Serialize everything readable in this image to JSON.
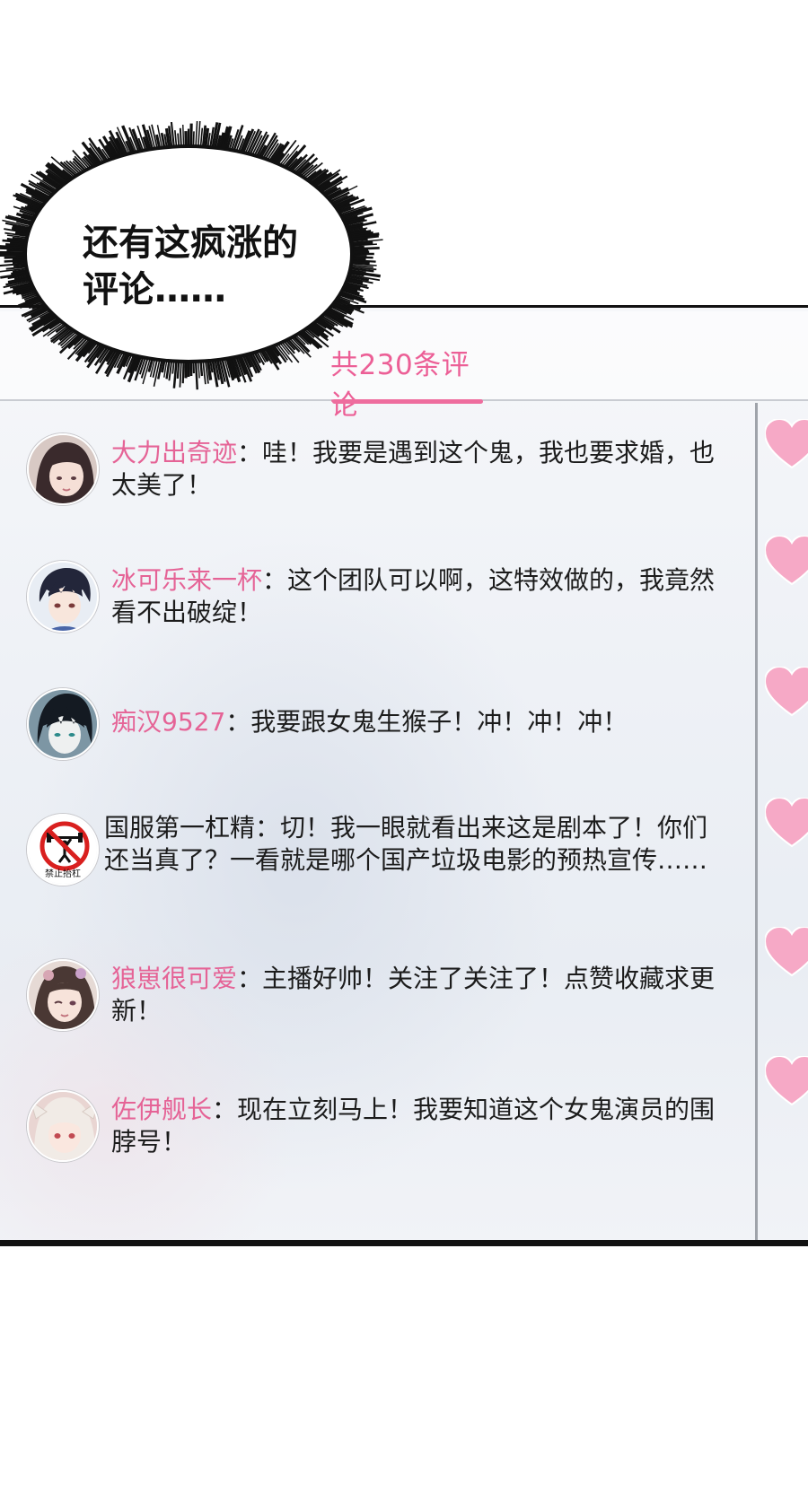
{
  "narration": {
    "bubble_text": "还有这疯涨的评论……"
  },
  "comments_panel": {
    "tab_title": "共230条评论",
    "accent_color": "#ec5f96",
    "heart_color": "#f6a9c6",
    "comments": [
      {
        "user": "大力出奇迹",
        "separator": "：",
        "text": "哇！我要是遇到这个鬼，我也要求婚，也太美了！",
        "avatar_icon": "anime-girl-avatar"
      },
      {
        "user": "冰可乐来一杯",
        "separator": "：",
        "text": "这个团队可以啊，这特效做的，我竟然看不出破绽！",
        "avatar_icon": "anime-boy-avatar"
      },
      {
        "user": "痴汉9527",
        "separator": "：",
        "text": "我要跟女鬼生猴子！冲！冲！冲！",
        "avatar_icon": "dark-hair-boy-avatar"
      },
      {
        "user": "国服第一杠精",
        "separator": "：",
        "text": "切！我一眼就看出来这是剧本了！你们还当真了？一看就是哪个国产垃圾电影的预热宣传……",
        "avatar_icon": "no-barbell-sign-avatar",
        "avatar_caption": "禁止抬杠"
      },
      {
        "user": "狼崽很可爱",
        "separator": "：",
        "text": "主播好帅！关注了关注了！点赞收藏求更新！",
        "avatar_icon": "winking-girl-avatar"
      },
      {
        "user": "佐伊舰长",
        "separator": "：",
        "text": "现在立刻马上！我要知道这个女鬼演员的围脖号！",
        "avatar_icon": "white-hair-girl-avatar"
      }
    ]
  }
}
